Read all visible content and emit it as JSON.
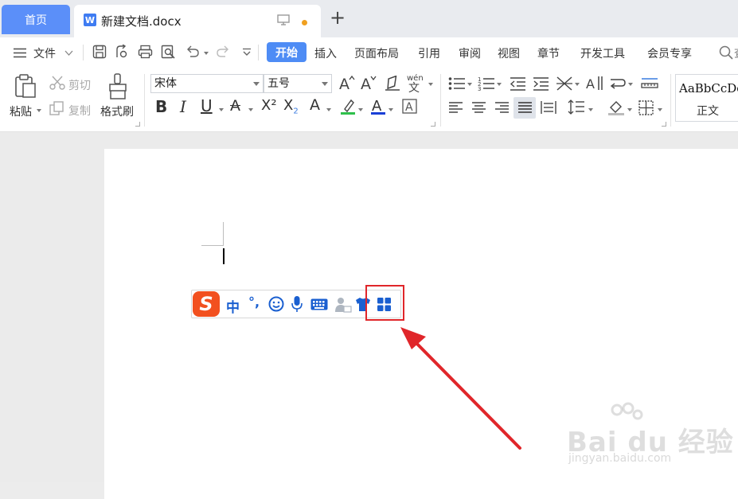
{
  "tabs": {
    "home": "首页",
    "doc_title": "新建文档.docx"
  },
  "menu": {
    "file": "文件",
    "items": [
      "开始",
      "插入",
      "页面布局",
      "引用",
      "审阅",
      "视图",
      "章节",
      "开发工具",
      "会员专享"
    ],
    "search_fragment": "查"
  },
  "ribbon": {
    "paste": "粘贴",
    "cut": "剪切",
    "copy": "复制",
    "format_painter": "格式刷",
    "font": "宋体",
    "font_size": "五号",
    "style_sample": "AaBbCcDd",
    "style_name": "正文"
  },
  "ime_toolbar": {
    "logo": "S",
    "mode": "中",
    "punct": "°,"
  },
  "watermark": {
    "brand": "Bai du 经验",
    "url": "jingyan.baidu.com"
  },
  "colors": {
    "accent": "#4e8cf5",
    "home_tab": "#5b8ff9",
    "highlight": "#e0262a",
    "ime_logo": "#f2501f",
    "ime_blue": "#1a5fd0"
  }
}
